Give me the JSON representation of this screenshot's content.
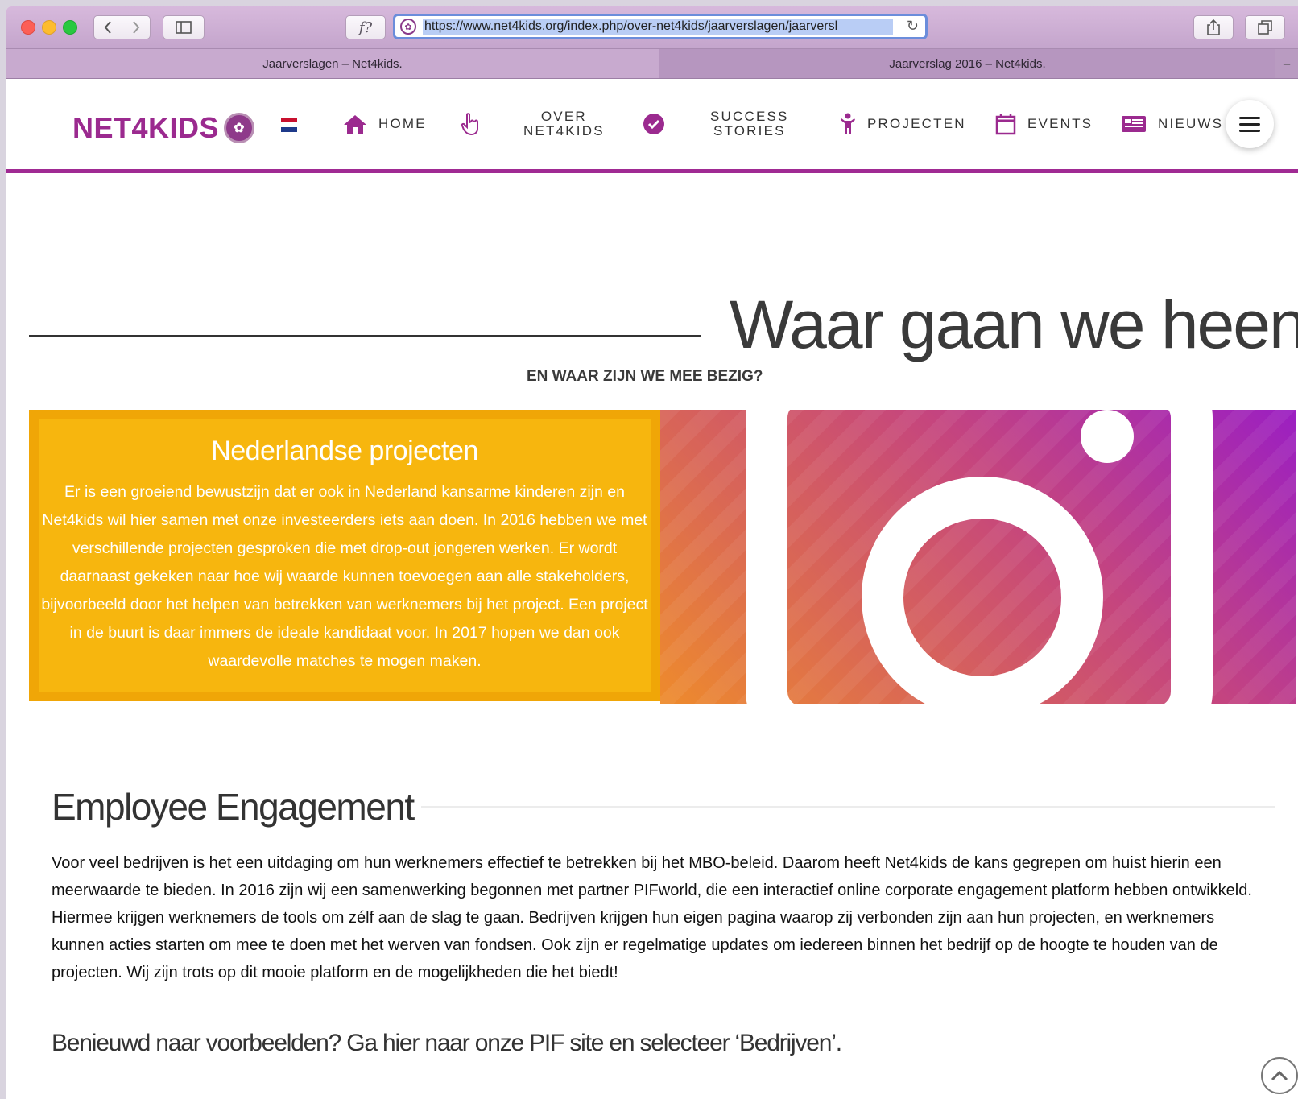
{
  "browser": {
    "url": "https://www.net4kids.org/index.php/over-net4kids/jaarverslagen/jaarversl",
    "reader_label": "f?",
    "tabs": [
      {
        "title": "Jaarverslagen – Net4kids."
      },
      {
        "title": "Jaarverslag 2016 – Net4kids."
      }
    ]
  },
  "site": {
    "logo_text": "NET4KIDS",
    "nav": {
      "home": "HOME",
      "over_line1": "OVER",
      "over_line2": "NET4KIDS",
      "success_line1": "SUCCESS",
      "success_line2": "STORIES",
      "projecten": "PROJECTEN",
      "events": "EVENTS",
      "nieuws": "NIEUWS"
    },
    "brand_color": "#a02a93",
    "accent_color": "#f7b60e"
  },
  "hero": {
    "title": "Waar gaan we heen",
    "subtitle": "EN WAAR ZIJN WE MEE BEZIG?"
  },
  "feature": {
    "title": "Nederlandse projecten",
    "text": "Er is een groeiend bewustzijn dat er ook in Nederland kansarme kinderen zijn en Net4kids wil hier samen met onze investeerders iets aan doen. In 2016 hebben we met verschillende projecten gesproken die met drop-out jongeren werken. Er wordt daarnaast gekeken naar hoe wij waarde kunnen toevoegen aan alle stakeholders, bijvoorbeeld door het helpen van betrekken van werknemers bij het project. Een project in de buurt is daar immers de ideale kandidaat voor. In 2017 hopen we dan ook waardevolle matches te mogen maken."
  },
  "section": {
    "title": "Employee Engagement",
    "text": "Voor veel bedrijven is het een uitdaging om hun werknemers effectief te betrekken bij het MBO-beleid. Daarom heeft Net4kids de kans gegrepen om huist hierin een meerwaarde te bieden. In 2016 zijn wij een samenwerking begonnen met partner PIFworld, die een interactief online corporate engagement platform hebben ontwikkeld. Hiermee krijgen werknemers de tools om zélf aan de slag te gaan. Bedrijven krijgen hun eigen pagina waarop zij verbonden zijn aan hun projecten, en werknemers kunnen acties starten om mee te doen met het werven van fondsen. Ook zijn er regelmatige updates om iedereen binnen het bedrijf op de hoogte te houden van de projecten. Wij zijn trots op dit mooie platform en de mogelijkheden die het biedt!",
    "cta": "Benieuwd naar voorbeelden? Ga hier naar onze PIF site en selecteer ‘Bedrijven’."
  },
  "icons": {
    "home": "home-icon",
    "over": "hand-pointer-icon",
    "success": "check-circle-icon",
    "projecten": "person-icon",
    "events": "calendar-icon",
    "nieuws": "newspaper-icon",
    "menu": "hamburger-icon",
    "scroll_top": "arrow-up-icon"
  }
}
